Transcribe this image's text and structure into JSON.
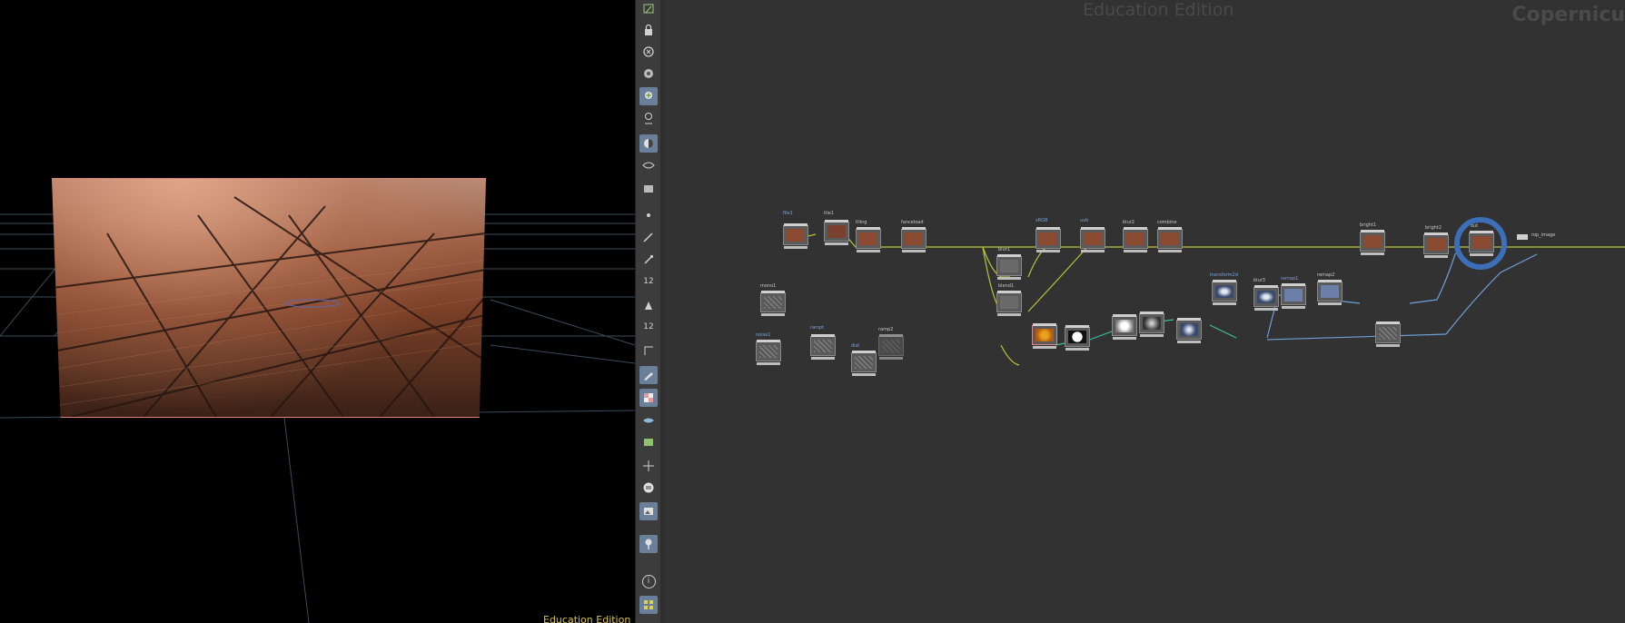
{
  "viewport": {
    "watermark": "Education Edition"
  },
  "toolbar": {
    "icons": [
      "select-icon",
      "lock-icon",
      "close-circle-icon",
      "camera-icon",
      "add-light-icon",
      "light-pin-icon",
      "shading-icon",
      "visibility-icon",
      "display-options-icon",
      "dot-icon",
      "brush-icon",
      "eyedropper-icon",
      "counter-12-icon",
      "paint-icon",
      "stamp-12-icon",
      "angle-icon",
      "pen-icon",
      "checker-icon",
      "eye-icon",
      "texture-icon",
      "transform-icon",
      "list-icon",
      "image-icon",
      "pin-icon",
      "info-icon",
      "grid-icon"
    ],
    "labels": {
      "counter1": "12",
      "counter2": "12",
      "info": "i"
    }
  },
  "network": {
    "watermark": "Education Edition",
    "context": "Copernicu",
    "node_labels": [
      "file1",
      "tile1",
      "tiling",
      "fanceload",
      "sRGB",
      "uvb",
      "blur1",
      "blend1",
      "blur2",
      "combine",
      "bright1",
      "bright2",
      "out",
      "rop_image",
      "mono1",
      "noise1",
      "rampt",
      "dist",
      "ramp2",
      "transform2d",
      "blur3",
      "remap1",
      "remap2"
    ]
  },
  "colors": {
    "wire_yellow": "#b8c43a",
    "wire_blue": "#6f9fd8",
    "wire_green": "#3fbf9a",
    "selection_ring": "#3d6fb8"
  }
}
